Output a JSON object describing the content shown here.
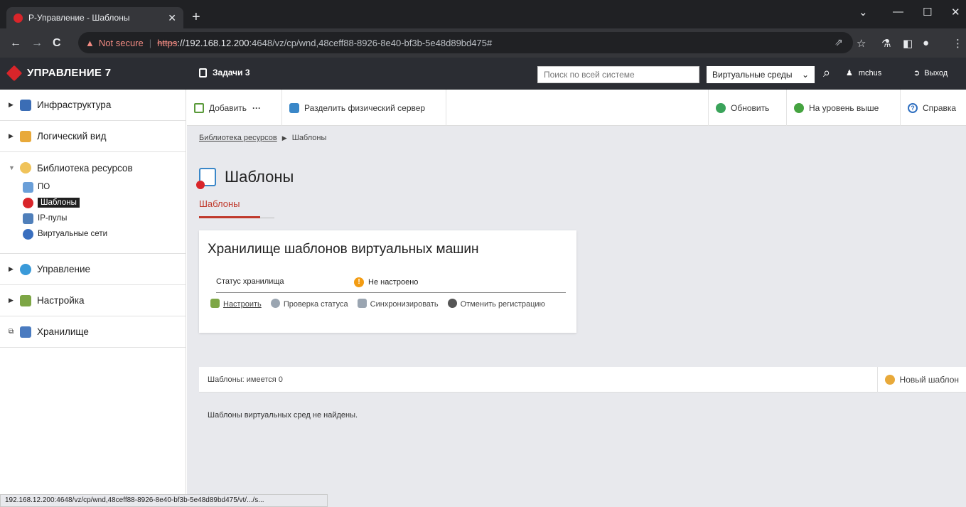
{
  "browser": {
    "tab_title": "Р-Управление - Шаблоны",
    "tab_close": "✕",
    "new_tab": "+",
    "minimize": "—",
    "restore": "☐",
    "close": "✕",
    "chevron": "⌄",
    "back": "←",
    "forward": "→",
    "reload": "C",
    "not_secure": "Not secure",
    "url_scheme": "https",
    "url_host": "://192.168.12.200",
    "url_rest": ":4648/vz/cp/wnd,48ceff88-8926-8e40-bf3b-5e48d89bd475#"
  },
  "header": {
    "brand": "УПРАВЛЕНИЕ 7",
    "tasks_label": "Задачи 3",
    "search_placeholder": "Поиск по всей системе",
    "env_select": "Виртуальные среды",
    "user": "mchus",
    "logout": "Выход"
  },
  "sidebar": {
    "items": [
      {
        "label": "Инфраструктура",
        "icon": "infrastructure-icon"
      },
      {
        "label": "Логический вид",
        "icon": "logical-view-icon"
      },
      {
        "label": "Библиотека ресурсов",
        "icon": "library-icon"
      },
      {
        "label": "Управление",
        "icon": "management-icon"
      },
      {
        "label": "Настройка",
        "icon": "settings-icon"
      },
      {
        "label": "Хранилище",
        "icon": "storage-icon"
      }
    ],
    "library_children": [
      {
        "label": "ПО"
      },
      {
        "label": "Шаблоны"
      },
      {
        "label": "IP-пулы"
      },
      {
        "label": "Виртуальные сети"
      }
    ]
  },
  "actionbar": {
    "add": "Добавить",
    "more": "···",
    "split": "Разделить физический сервер",
    "refresh": "Обновить",
    "up": "На уровень выше",
    "help": "Справка"
  },
  "breadcrumb": {
    "parent": "Библиотека ресурсов",
    "sep": "▶",
    "current": "Шаблоны"
  },
  "page": {
    "title": "Шаблоны",
    "tab": "Шаблоны"
  },
  "card": {
    "title": "Хранилище шаблонов виртуальных машин",
    "status_label": "Статус хранилища",
    "status_value": "Не настроено",
    "configure": "Настроить",
    "check_status": "Проверка статуса",
    "sync": "Синхронизировать",
    "cancel_reg": "Отменить регистрацию"
  },
  "list": {
    "count": "Шаблоны: имеется 0",
    "new_template": "Новый шаблон",
    "empty": "Шаблоны виртуальных сред не найдены."
  },
  "statusbar": {
    "url": "192.168.12.200:4648/vz/cp/wnd,48ceff88-8926-8e40-bf3b-5e48d89bd475/vt/.../s..."
  },
  "colors": {
    "brand_red": "#d9252a",
    "header_dark": "#2b2d33",
    "accent_tab": "#c0392b",
    "warn": "#f39c12",
    "page_bg": "#e8e9ed"
  }
}
